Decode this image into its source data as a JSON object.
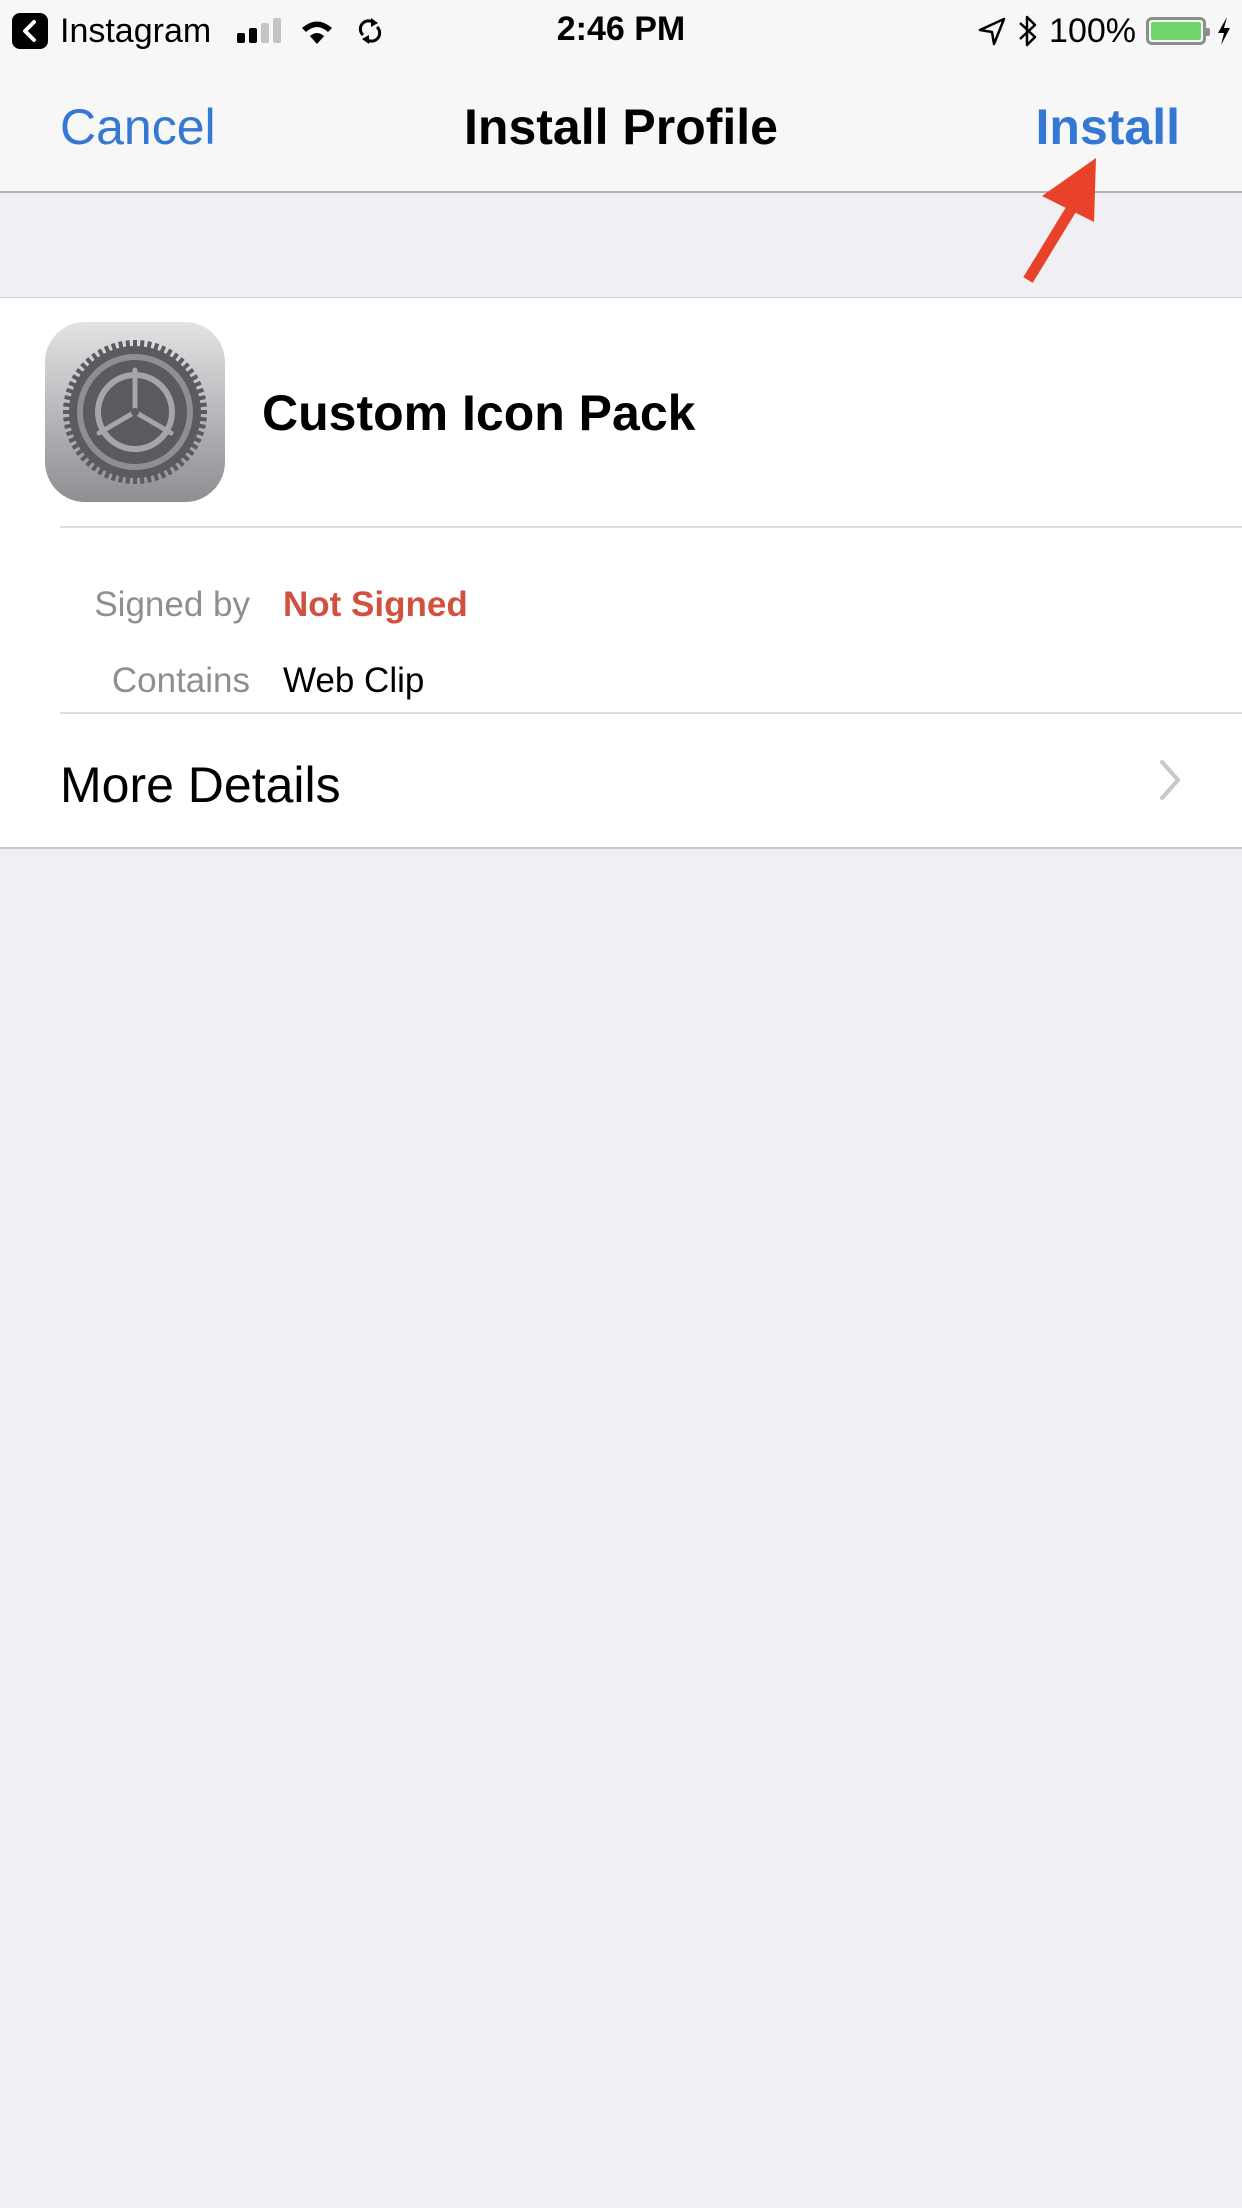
{
  "status_bar": {
    "back_app_label": "Instagram",
    "time": "2:46 PM",
    "battery_percent_label": "100%",
    "battery_level": 1.0,
    "signal_bars_filled": 2,
    "signal_bars_total": 4,
    "icons": [
      "back-chevron-icon",
      "signal-icon",
      "wifi-icon",
      "sync-icon",
      "location-icon",
      "bluetooth-icon",
      "battery-icon",
      "charging-icon"
    ]
  },
  "nav": {
    "cancel_label": "Cancel",
    "title": "Install Profile",
    "install_label": "Install"
  },
  "profile": {
    "name": "Custom Icon Pack",
    "icon": "settings-gear-icon",
    "details": [
      {
        "label": "Signed by",
        "value": "Not Signed"
      },
      {
        "label": "Contains",
        "value": "Web Clip"
      }
    ],
    "more_details_label": "More Details"
  },
  "colors": {
    "accent": "#3478d4",
    "warning": "#d0513f",
    "annotation_arrow": "#e8432a",
    "background": "#efeff4"
  }
}
